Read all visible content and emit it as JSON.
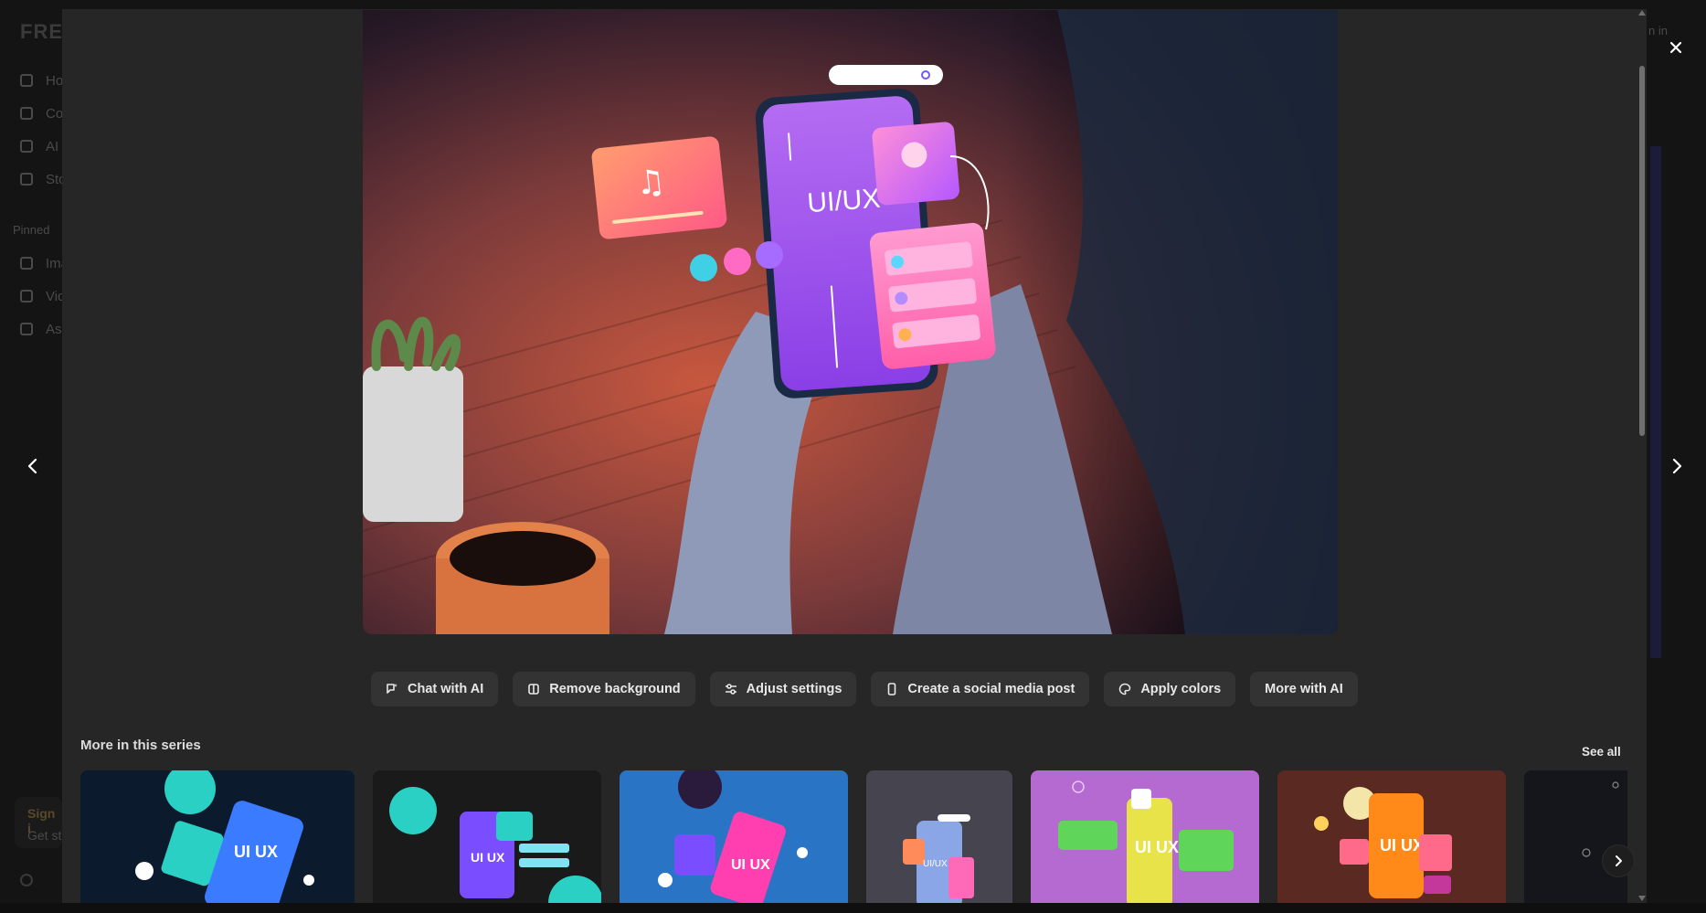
{
  "background_page": {
    "logo": "FRE",
    "nav_items": [
      "Ho",
      "Co",
      "AI",
      "Sto"
    ],
    "pinned_label": "Pinned",
    "pinned_items": [
      "Ima",
      "Vid",
      "As"
    ],
    "signin_card": {
      "title": "Sign i",
      "subtitle": "Get st"
    },
    "top_signin": "n in"
  },
  "hero": {
    "alt": "Hands holding smartphone with UI/UX interface illustration",
    "phone_text": "UI/UX"
  },
  "actions": [
    {
      "label": "Chat with AI",
      "icon": "chat-ai-icon"
    },
    {
      "label": "Remove background",
      "icon": "remove-background-icon"
    },
    {
      "label": "Adjust settings",
      "icon": "sliders-icon"
    },
    {
      "label": "Create a social media post",
      "icon": "phone-icon"
    },
    {
      "label": "Apply colors",
      "icon": "palette-icon"
    },
    {
      "label": "More with AI",
      "icon": ""
    }
  ],
  "series": {
    "title": "More in this series",
    "see_all": "See all",
    "thumbnails": [
      {
        "label": "UI UX",
        "bg": "#0b1a2c"
      },
      {
        "label": "UI UX",
        "bg": "#1a1a1a"
      },
      {
        "label": "UI UX",
        "bg": "#2a74c6"
      },
      {
        "label": "UI/UX",
        "bg": "#3b3b44"
      },
      {
        "label": "UI UX",
        "bg": "#b46ad0"
      },
      {
        "label": "UI UX",
        "bg": "#5a2a22"
      },
      {
        "label": "",
        "bg": "#14161c"
      }
    ]
  },
  "colors": {
    "modal_bg": "#262626",
    "button_bg": "#333333",
    "page_bg": "#0d0d0d"
  }
}
